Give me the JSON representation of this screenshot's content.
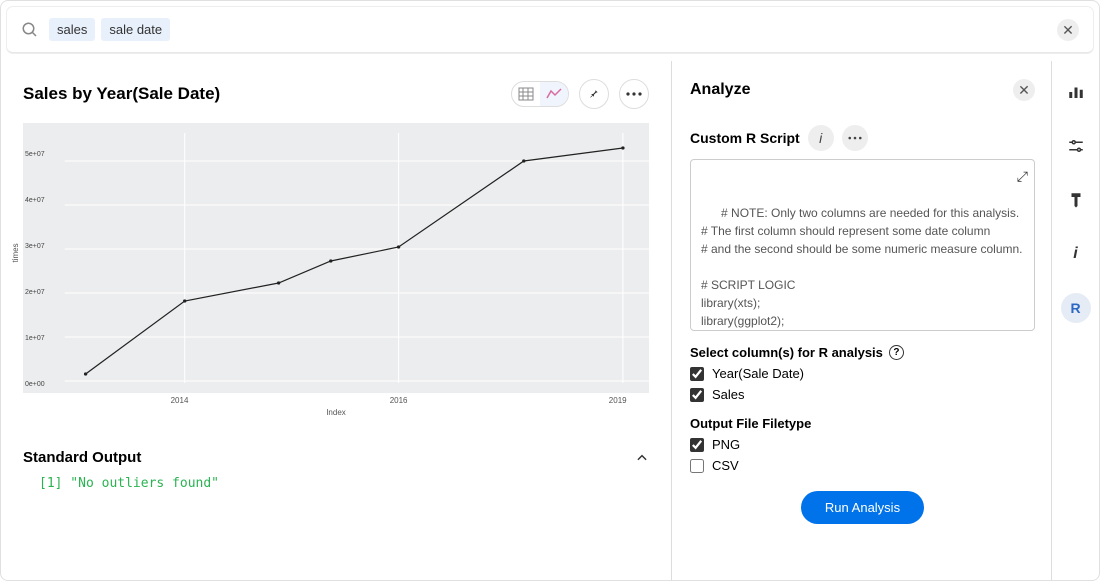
{
  "search": {
    "tokens": [
      "sales",
      "sale date"
    ]
  },
  "chart": {
    "title": "Sales by Year(Sale Date)",
    "ylabel": "times",
    "xlabel": "Index",
    "xticks": [
      "2014",
      "2016",
      "2019"
    ],
    "yticks": [
      "0e+00",
      "1e+07",
      "2e+07",
      "3e+07",
      "4e+07",
      "5e+07"
    ]
  },
  "chart_data": {
    "type": "line",
    "x": [
      2013,
      2014,
      2015,
      2016,
      2017,
      2018,
      2019
    ],
    "y": [
      1500000,
      18000000,
      22000000,
      27000000,
      30000000,
      50000000,
      53000000
    ],
    "xlabel": "Index",
    "ylabel": "times",
    "title": "Sales by Year(Sale Date)",
    "ylim": [
      0,
      55000000
    ],
    "xlim": [
      2013,
      2019
    ]
  },
  "std_output": {
    "title": "Standard Output",
    "line": "[1] \"No outliers found\""
  },
  "analyze": {
    "title": "Analyze",
    "script_title": "Custom R Script",
    "script": "# NOTE: Only two columns are needed for this analysis.\n# The first column should represent some date column\n# and the second should be some numeric measure column.\n\n# SCRIPT LOGIC\nlibrary(xts);\nlibrary(ggplot2);\nlibrary(forecast);\n\ncolnames(df) <- c(\"Date\", \"Values\");",
    "columns_label": "Select column(s) for R analysis",
    "columns": [
      {
        "label": "Year(Sale Date)",
        "checked": true
      },
      {
        "label": "Sales",
        "checked": true
      }
    ],
    "filetype_label": "Output File Filetype",
    "filetypes": [
      {
        "label": "PNG",
        "checked": true
      },
      {
        "label": "CSV",
        "checked": false
      }
    ],
    "run_label": "Run Analysis"
  },
  "icons": {
    "chart_toggle_table": "table-icon",
    "chart_toggle_line": "line-icon",
    "pin": "pin-icon",
    "more": "more-icon"
  }
}
